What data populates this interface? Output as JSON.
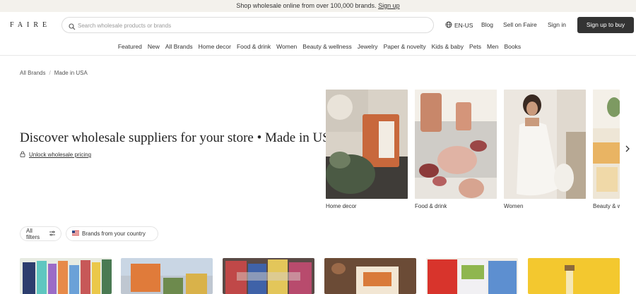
{
  "banner": {
    "text": "Shop wholesale online from over 100,000 brands.",
    "link": "Sign up"
  },
  "header": {
    "logo": "FAIRE",
    "search_placeholder": "Search wholesale products or brands",
    "lang": "EN-US",
    "blog": "Blog",
    "sell": "Sell on Faire",
    "signin": "Sign in",
    "signup": "Sign up to buy"
  },
  "nav": [
    "Featured",
    "New",
    "All Brands",
    "Home decor",
    "Food & drink",
    "Women",
    "Beauty & wellness",
    "Jewelry",
    "Paper & novelty",
    "Kids & baby",
    "Pets",
    "Men",
    "Books"
  ],
  "breadcrumb": [
    "All Brands",
    "Made in USA"
  ],
  "hero": {
    "title": "Discover wholesale suppliers for your store • Made in USA",
    "unlock": "Unlock wholesale pricing"
  },
  "categories": [
    "Home decor",
    "Food & drink",
    "Women",
    "Beauty & wellness"
  ],
  "filters": {
    "all": "All filters",
    "country": "Brands from your country"
  },
  "icons": [
    "globe-icon",
    "search-icon",
    "lock-icon",
    "filter-icon",
    "flag-icon",
    "chevron-right-icon"
  ],
  "colors": {
    "dark": "#333333",
    "banner_bg": "#f3f1ec"
  }
}
